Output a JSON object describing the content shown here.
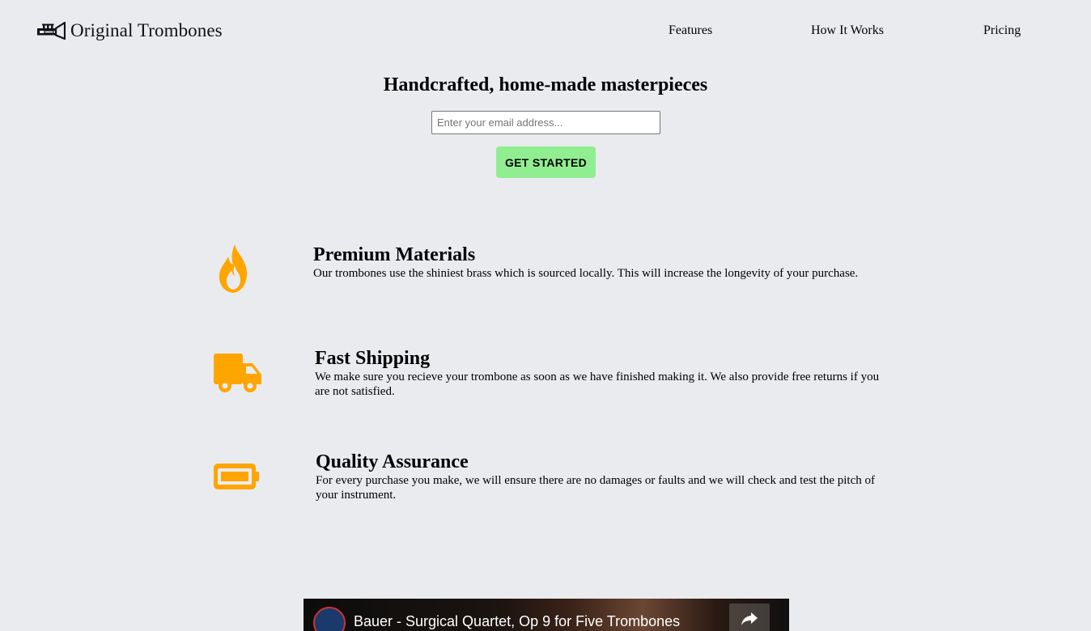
{
  "header": {
    "logo_text": "Original Trombones",
    "logo_icon": "trumpet-icon",
    "nav": [
      {
        "label": "Features"
      },
      {
        "label": "How It Works"
      },
      {
        "label": "Pricing"
      }
    ]
  },
  "hero": {
    "title": "Handcrafted, home-made masterpieces",
    "email_placeholder": "Enter your email address...",
    "email_value": "",
    "cta_label": "GET STARTED",
    "cta_color": "#90ee90"
  },
  "features": [
    {
      "icon": "fire-icon",
      "title": "Premium Materials",
      "text": "Our trombones use the shiniest brass which is sourced locally. This will increase the longevity of your purchase."
    },
    {
      "icon": "truck-icon",
      "title": "Fast Shipping",
      "text": "We make sure you recieve your trombone as soon as we have finished making it. We also provide free returns if you are not satisfied."
    },
    {
      "icon": "battery-full-icon",
      "title": "Quality Assurance",
      "text": "For every purchase you make, we will ensure there are no damages or faults and we will check and test the pitch of your instrument."
    }
  ],
  "video": {
    "title": "Bauer - Surgical Quartet, Op 9 for Five Trombones",
    "share_icon": "share-icon"
  },
  "colors": {
    "background": "#eaebef",
    "icon_accent": "#ffa500"
  }
}
